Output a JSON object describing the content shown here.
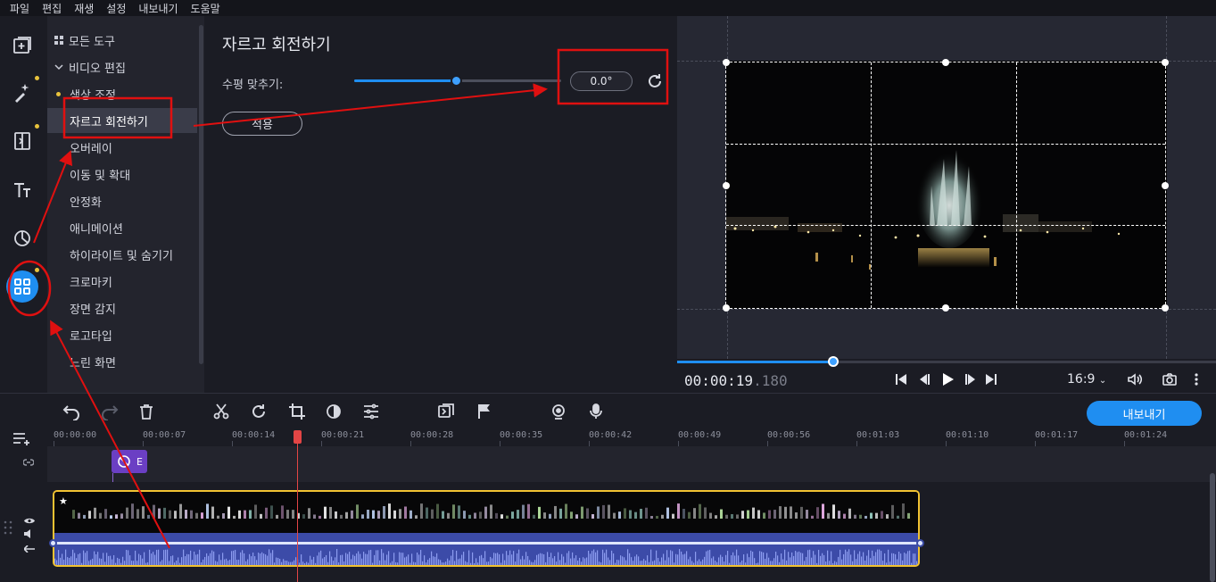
{
  "menu": [
    "파일",
    "편집",
    "재생",
    "설정",
    "내보내기",
    "도움말"
  ],
  "rail_icons": [
    "add-media-icon",
    "magic-wand-icon",
    "transitions-icon",
    "titles-icon",
    "stickers-icon",
    "more-tools-icon"
  ],
  "tools": {
    "all_tools": "모든 도구",
    "video_edit": "비디오 편집",
    "items": [
      "색상 조정",
      "자르고 회전하기",
      "오버레이",
      "이동 및 확대",
      "안정화",
      "애니메이션",
      "하이라이트 및 숨기기",
      "크로마키",
      "장면 감지",
      "로고타입",
      "느린 화면"
    ],
    "selected_index": 1
  },
  "panel": {
    "title": "자르고 회전하기",
    "straighten_label": "수평 맞추기:",
    "straighten_value": "0.0°",
    "slider_fraction": 0.49,
    "apply_label": "적용"
  },
  "player": {
    "timecode_main": "00:00:19",
    "timecode_ms": ".180",
    "aspect_ratio": "16:9",
    "progress_fraction": 0.29
  },
  "toolbar": {
    "export_label": "내보내기"
  },
  "ruler": [
    "00:00:00",
    "00:00:07",
    "00:00:14",
    "00:00:21",
    "00:00:28",
    "00:00:35",
    "00:00:42",
    "00:00:49",
    "00:00:56",
    "00:01:03",
    "00:01:10",
    "00:01:17",
    "00:01:24"
  ],
  "effect_clip_label": "E",
  "colors": {
    "accent": "#1f8ef1",
    "annotation": "#e01010",
    "clip_border": "#f1c232"
  }
}
